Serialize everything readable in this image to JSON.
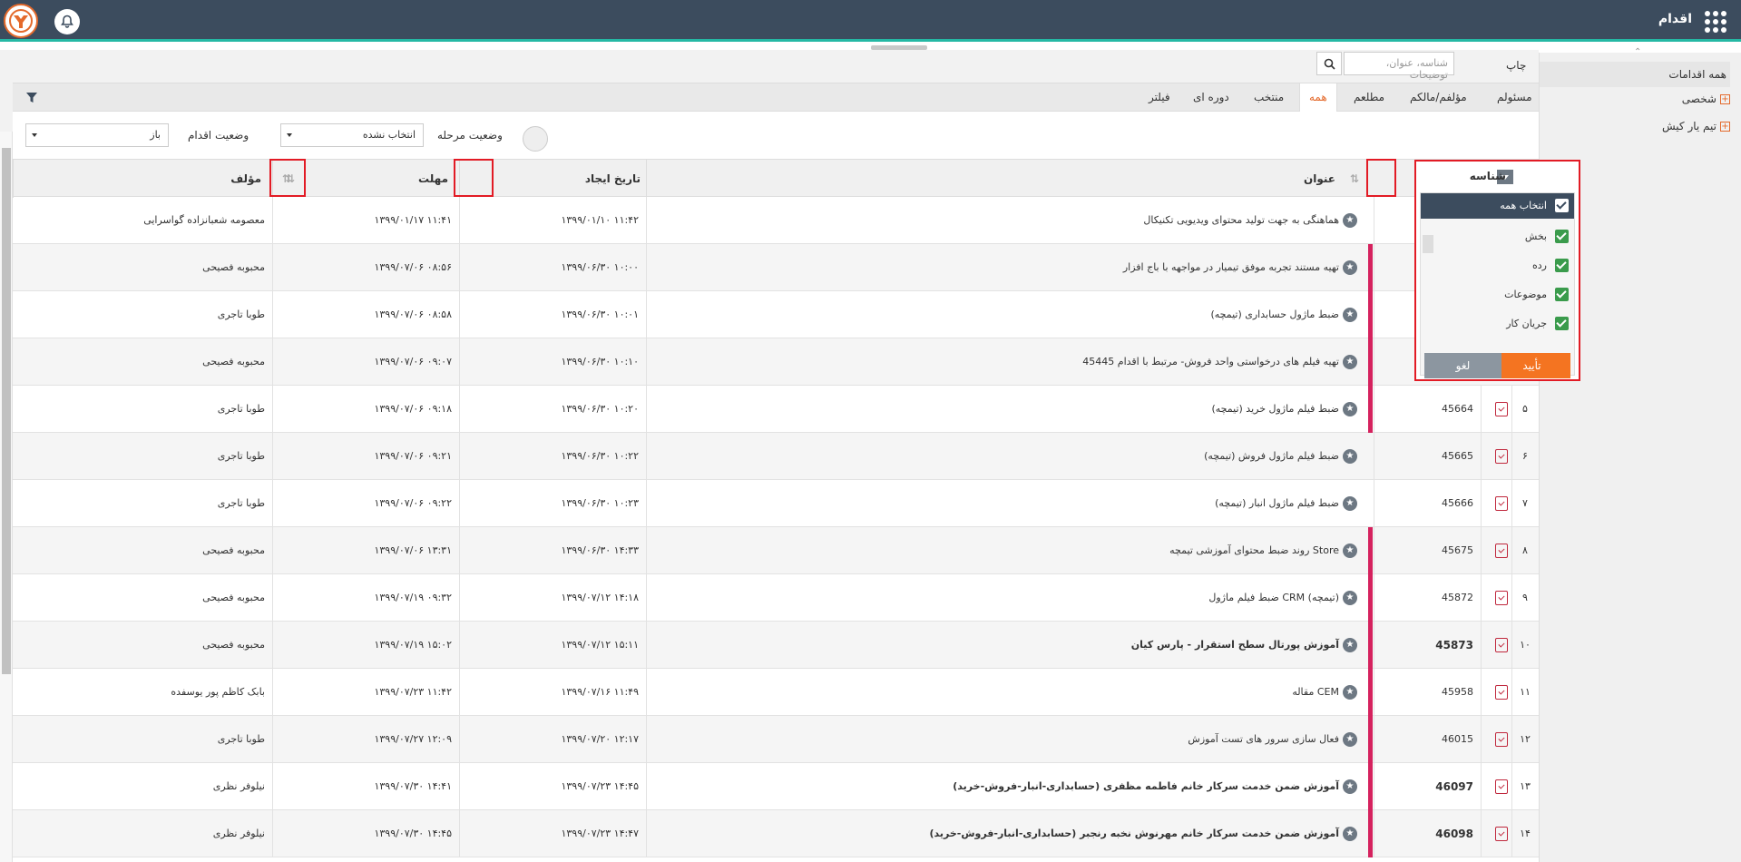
{
  "app": {
    "title": "اقدام"
  },
  "sidebar": {
    "all_label": "همه اقدامات",
    "items": [
      {
        "label": "شخصی"
      },
      {
        "label": "تیم یار کیش"
      }
    ]
  },
  "toolbar": {
    "print_label": "چاپ",
    "search_placeholder": "شناسه، عنوان، توضیحات"
  },
  "tabs": [
    {
      "label": "مسئولم"
    },
    {
      "label": "مؤلفم/مالکم"
    },
    {
      "label": "مطلعم"
    },
    {
      "label": "همه"
    },
    {
      "label": "منتخب"
    },
    {
      "label": "دوره ای"
    },
    {
      "label": "فیلتر"
    }
  ],
  "active_tab": "همه",
  "filters": {
    "stage_status_label": "وضعیت مرحله",
    "stage_status_value": "انتخاب نشده",
    "action_status_label": "وضعیت اقدام",
    "action_status_value": "باز"
  },
  "table": {
    "headers": {
      "id": "شناسه",
      "title": "عنوان",
      "created": "تاریخ ایجاد",
      "deadline": "مهلت",
      "author": "مؤلف"
    },
    "rows": [
      {
        "num": "",
        "id": "",
        "title": "هماهنگی به جهت تولید محتوای ویدیویی تکنیکال",
        "created": "۱۳۹۹/۰۱/۱۰ ۱۱:۴۲",
        "deadline": "۱۳۹۹/۰۱/۱۷ ۱۱:۴۱",
        "author": "معصومه شعبانزاده گواسرایی",
        "bold": false,
        "pink": false
      },
      {
        "num": "",
        "id": "",
        "title": "تهیه مستند تجربه موفق تیمیار در مواجهه با باج افزار",
        "created": "۱۳۹۹/۰۶/۳۰ ۱۰:۰۰",
        "deadline": "۱۳۹۹/۰۷/۰۶ ۰۸:۵۶",
        "author": "محبوبه فصیحی",
        "bold": false,
        "pink": true
      },
      {
        "num": "",
        "id": "",
        "title": "ضبط ماژول حسابداری (تیمچه)",
        "created": "۱۳۹۹/۰۶/۳۰ ۱۰:۰۱",
        "deadline": "۱۳۹۹/۰۷/۰۶ ۰۸:۵۸",
        "author": "طوبا تاجری",
        "bold": false,
        "pink": true
      },
      {
        "num": "",
        "id": "",
        "title": "تهیه فیلم های درخواستی واحد فروش- مرتبط با اقدام 45445",
        "created": "۱۳۹۹/۰۶/۳۰ ۱۰:۱۰",
        "deadline": "۱۳۹۹/۰۷/۰۶ ۰۹:۰۷",
        "author": "محبوبه فصیحی",
        "bold": false,
        "pink": true
      },
      {
        "num": "۵",
        "id": "45664",
        "title": "ضبط فیلم ماژول خرید (تیمچه)",
        "created": "۱۳۹۹/۰۶/۳۰ ۱۰:۲۰",
        "deadline": "۱۳۹۹/۰۷/۰۶ ۰۹:۱۸",
        "author": "طوبا تاجری",
        "bold": false,
        "pink": true
      },
      {
        "num": "۶",
        "id": "45665",
        "title": "ضبط فیلم ماژول فروش (تیمچه)",
        "created": "۱۳۹۹/۰۶/۳۰ ۱۰:۲۲",
        "deadline": "۱۳۹۹/۰۷/۰۶ ۰۹:۲۱",
        "author": "طوبا تاجری",
        "bold": false,
        "pink": false
      },
      {
        "num": "۷",
        "id": "45666",
        "title": "ضبط فیلم ماژول انبار (تیمچه)",
        "created": "۱۳۹۹/۰۶/۳۰ ۱۰:۲۳",
        "deadline": "۱۳۹۹/۰۷/۰۶ ۰۹:۲۲",
        "author": "طوبا تاجری",
        "bold": false,
        "pink": false
      },
      {
        "num": "۸",
        "id": "45675",
        "title": "روند ضبط محتوای آموزشی تیمچه Store",
        "created": "۱۳۹۹/۰۶/۳۰ ۱۴:۳۳",
        "deadline": "۱۳۹۹/۰۷/۰۶ ۱۳:۳۱",
        "author": "محبوبه فصیحی",
        "bold": false,
        "pink": true
      },
      {
        "num": "۹",
        "id": "45872",
        "title": "ضبط فیلم ماژول CRM (تیمچه)",
        "created": "۱۳۹۹/۰۷/۱۲ ۱۴:۱۸",
        "deadline": "۱۳۹۹/۰۷/۱۹ ۰۹:۳۲",
        "author": "محبوبه فصیحی",
        "bold": false,
        "pink": true
      },
      {
        "num": "۱۰",
        "id": "45873",
        "title": "آموزش پورتال سطح استقرار - پارس کیان",
        "created": "۱۳۹۹/۰۷/۱۲ ۱۵:۱۱",
        "deadline": "۱۳۹۹/۰۷/۱۹ ۱۵:۰۲",
        "author": "محبوبه فصیحی",
        "bold": true,
        "pink": true
      },
      {
        "num": "۱۱",
        "id": "45958",
        "title": "مقاله CEM",
        "created": "۱۳۹۹/۰۷/۱۶ ۱۱:۴۹",
        "deadline": "۱۳۹۹/۰۷/۲۳ ۱۱:۴۲",
        "author": "بابک کاظم پور یوسفده",
        "bold": false,
        "pink": true
      },
      {
        "num": "۱۲",
        "id": "46015",
        "title": "فعال سازی سرور های تست آموزش",
        "created": "۱۳۹۹/۰۷/۲۰ ۱۲:۱۷",
        "deadline": "۱۳۹۹/۰۷/۲۷ ۱۲:۰۹",
        "author": "طوبا تاجری",
        "bold": false,
        "pink": true
      },
      {
        "num": "۱۳",
        "id": "46097",
        "title": "آموزش ضمن خدمت سرکار خانم فاطمه مظفری (حسابداری-انبار-فروش-خرید)",
        "created": "۱۳۹۹/۰۷/۲۳ ۱۴:۴۵",
        "deadline": "۱۳۹۹/۰۷/۳۰ ۱۴:۴۱",
        "author": "نیلوفر نظری",
        "bold": true,
        "pink": true
      },
      {
        "num": "۱۴",
        "id": "46098",
        "title": "آموزش ضمن خدمت سرکار خانم مهرنوش نخبه رنجبر (حسابداری-انبار-فروش-خرید)",
        "created": "۱۳۹۹/۰۷/۲۳ ۱۴:۴۷",
        "deadline": "۱۳۹۹/۰۷/۳۰ ۱۴:۴۵",
        "author": "نیلوفر نظری",
        "bold": true,
        "pink": true
      }
    ]
  },
  "column_picker": {
    "select_all": "انتخاب همه",
    "items": [
      {
        "label": "بخش"
      },
      {
        "label": "رده"
      },
      {
        "label": "موضوعات"
      },
      {
        "label": "جریان کار"
      }
    ],
    "ok_label": "تأیید",
    "cancel_label": "لغو"
  },
  "colors": {
    "topbar": "#3c4c5e",
    "accent": "#f47421",
    "highlight": "#e21b25",
    "row_marker": "#d5225e"
  }
}
